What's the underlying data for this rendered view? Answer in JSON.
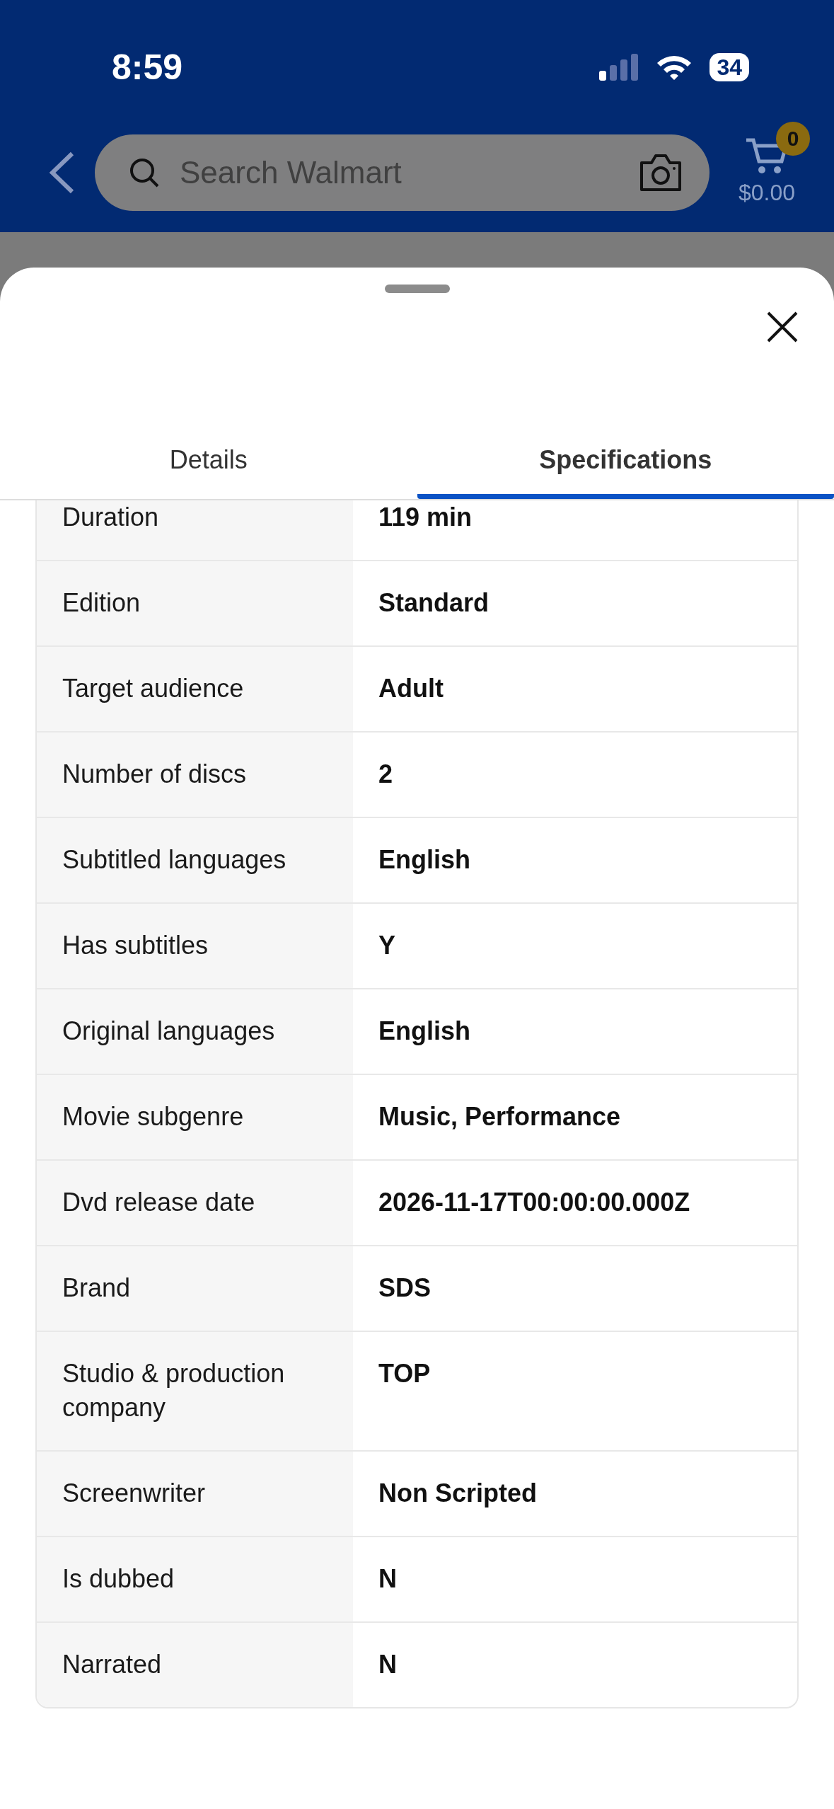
{
  "status_bar": {
    "time": "8:59",
    "battery": "34"
  },
  "header": {
    "search": {
      "placeholder": "Search Walmart"
    },
    "cart": {
      "badge": "0",
      "total": "$0.00"
    }
  },
  "tabs": [
    {
      "label": "Details",
      "selected": false
    },
    {
      "label": "Specifications",
      "selected": true
    }
  ],
  "specs": [
    {
      "name": "Duration",
      "value": "119 min"
    },
    {
      "name": "Edition",
      "value": "Standard"
    },
    {
      "name": "Target audience",
      "value": "Adult"
    },
    {
      "name": "Number of discs",
      "value": "2"
    },
    {
      "name": "Subtitled languages",
      "value": "English"
    },
    {
      "name": "Has subtitles",
      "value": "Y"
    },
    {
      "name": "Original languages",
      "value": "English"
    },
    {
      "name": "Movie subgenre",
      "value": "Music, Performance"
    },
    {
      "name": "Dvd release date",
      "value": "2026-11-17T00:00:00.000Z"
    },
    {
      "name": "Brand",
      "value": "SDS"
    },
    {
      "name": "Studio & production company",
      "value": "TOP"
    },
    {
      "name": "Screenwriter",
      "value": "Non Scripted"
    },
    {
      "name": "Is dubbed",
      "value": "N"
    },
    {
      "name": "Narrated",
      "value": "N"
    }
  ]
}
